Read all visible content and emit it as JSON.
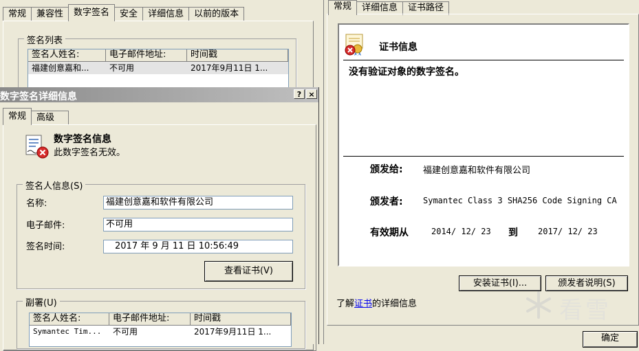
{
  "back_window": {
    "tabs": [
      "常规",
      "兼容性",
      "数字签名",
      "安全",
      "详细信息",
      "以前的版本"
    ],
    "group_title": "签名列表",
    "columns": [
      "签名人姓名:",
      "电子邮件地址:",
      "时间戳"
    ],
    "rows": [
      [
        "福建创意嘉和...",
        "不可用",
        "2017年9月11日 1..."
      ]
    ]
  },
  "dialog": {
    "title": "数字签名详细信息",
    "help_button": "?",
    "close_button": "×",
    "tabs": [
      "常规",
      "高级"
    ],
    "info_title": "数字签名信息",
    "info_status": "此数字签名无效。",
    "signer_group": {
      "title": "签名人信息(S)",
      "name_label": "名称:",
      "name_value": "福建创意嘉和软件有限公司",
      "email_label": "电子邮件:",
      "email_value": "不可用",
      "time_label": "签名时间:",
      "time_value": "2017  年  9  月  11  日 10:56:49",
      "view_cert_button": "查看证书(V)"
    },
    "countersig_group": {
      "title": "副署(U)",
      "columns": [
        "签名人姓名:",
        "电子邮件地址:",
        "时间戳"
      ],
      "rows": [
        [
          "Symantec Tim...",
          "不可用",
          "2017年9月11日 1..."
        ]
      ]
    }
  },
  "cert_window": {
    "tabs": [
      "常规",
      "详细信息",
      "证书路径"
    ],
    "header": "证书信息",
    "status_text": "没有验证对象的数字签名。",
    "issued_to_label": "颁发给:",
    "issued_to_value": "福建创意嘉和软件有限公司",
    "issued_by_label": "颁发者:",
    "issued_by_value": "Symantec Class 3 SHA256 Code Signing CA",
    "validity_label": "有效期从",
    "valid_from": "2014/  12/  23",
    "validity_to": "到",
    "valid_to": "2017/  12/  23",
    "install_button": "安装证书(I)...",
    "issuer_statement_button": "颁发者说明(S)",
    "learn_more_prefix": "了解",
    "learn_more_link": "证书",
    "learn_more_suffix": "的详细信息",
    "ok_button": "确定",
    "watermark": "看雪"
  }
}
